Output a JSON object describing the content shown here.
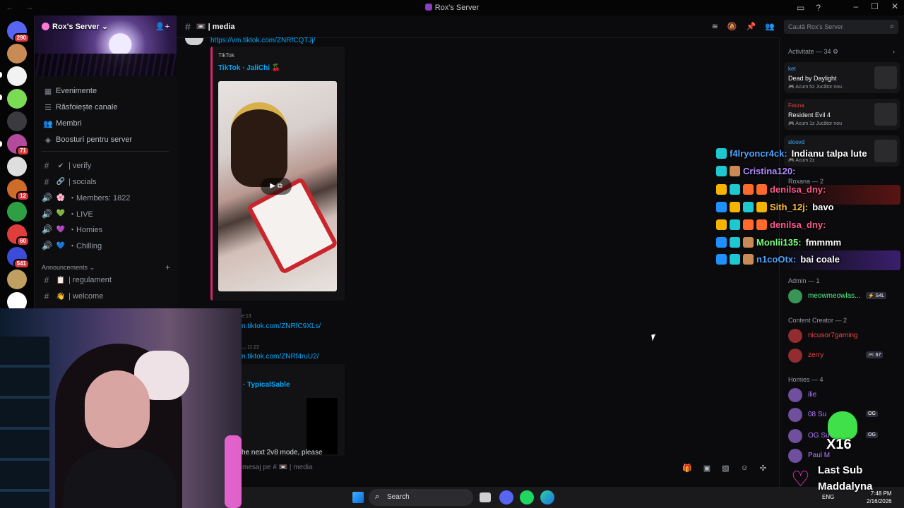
{
  "window": {
    "title": "Rox's Server",
    "nav": "← →"
  },
  "server_list": {
    "badges": [
      "290",
      "71",
      "12",
      "60",
      "541"
    ],
    "colors": [
      "#5865f2",
      "#c98b55",
      "#f2f2f2",
      "#7bdb55",
      "#3a3a40",
      "#b34a9e",
      "#dedede",
      "#d06c2a",
      "#2ea043",
      "#e23d3d",
      "#3b4dd8",
      "#c0a060",
      "#ffffff"
    ]
  },
  "sidebar": {
    "server_name": "Rox's Server",
    "server_chevron": "⌄",
    "nav": [
      {
        "icon": "calendar-icon",
        "glyph": "▦",
        "label": "Evenimente"
      },
      {
        "icon": "browse-channels-icon",
        "glyph": "☰",
        "label": "Răsfoiește canale"
      },
      {
        "icon": "members-icon",
        "glyph": "👥",
        "label": "Membri"
      },
      {
        "icon": "boost-icon",
        "glyph": "◈",
        "label": "Boosturi pentru server"
      }
    ],
    "channels": [
      {
        "glyph": "#",
        "emoji": "✔",
        "label": "| verify"
      },
      {
        "glyph": "#",
        "emoji": "🔗",
        "label": "| socials"
      },
      {
        "glyph": "🔊",
        "emoji": "🌸",
        "label": "・Members: 1822"
      },
      {
        "glyph": "🔊",
        "emoji": "💚",
        "label": "・LIVE"
      },
      {
        "glyph": "🔊",
        "emoji": "💜",
        "label": "・Homies"
      },
      {
        "glyph": "🔊",
        "emoji": "💙",
        "label": "・Chilling"
      }
    ],
    "category": "Announcements",
    "category_channels": [
      {
        "glyph": "#",
        "emoji": "📋",
        "label": "| regulament"
      },
      {
        "glyph": "#",
        "emoji": "👋",
        "label": "| welcome"
      }
    ]
  },
  "header": {
    "channel": "| media",
    "channel_emoji": "📼"
  },
  "search": {
    "placeholder": "Caută Rox's Server"
  },
  "messages": {
    "link1": "https://vm.tiktok.com/ZNRfCQTJj/",
    "embed_provider": "TikTok",
    "embed_author": "TikTok · JaliChi 🍒",
    "time2": "e:13",
    "link2": "n.tiktok.com/ZNRfC9XLs/",
    "time3": "11:22",
    "link3": "n.tiktok.com/ZNRf4ruU2/",
    "embed2_author": "· TypicalSable",
    "embed2_text": "he next 2v8 mode, please"
  },
  "composer": {
    "placeholder": "mesaj pe # 📼 | media"
  },
  "activity": {
    "header": "Activitate — 34",
    "cards": [
      {
        "user": "ket",
        "game": "Dead by Daylight",
        "time": "Acum 5z",
        "status": "Jucător nou",
        "user_color": "#3ba9ff"
      },
      {
        "user": "Fauna",
        "game": "Resident Evil 4",
        "time": "Acum 1z",
        "status": "Jucător nou",
        "user_color": "#e23d3d"
      },
      {
        "user": "sloovd",
        "game": "",
        "time": "Acum 2z",
        "status": "",
        "user_color": "#3ba9ff"
      }
    ]
  },
  "member_sections": [
    {
      "label": "Admin — 1",
      "members": [
        {
          "name": "meowmeowlas...",
          "color": "#57f287",
          "tag": "⚡ S4L"
        }
      ]
    },
    {
      "label": "Content Creator — 2",
      "members": [
        {
          "name": "nicusor7gaming",
          "color": "#ed4245",
          "tag": ""
        },
        {
          "name": "zerry",
          "color": "#ed4245",
          "tag": "🎮 67"
        }
      ]
    },
    {
      "label": "Homies — 4",
      "members": [
        {
          "name": "ilie",
          "color": "#b27dff",
          "tag": ""
        },
        {
          "name": "08 Su",
          "color": "#b27dff",
          "tag": "OG"
        },
        {
          "name": "OG Su",
          "color": "#b27dff",
          "tag": "OG"
        },
        {
          "name": "Paul M",
          "color": "#b27dff",
          "tag": ""
        }
      ]
    },
    {
      "label": "Roxana — 2",
      "members": []
    }
  ],
  "stream_chat": [
    {
      "user": "f4lryoncr4ck:",
      "color": "#4ea3ff",
      "msg": "Indianu talpa lute"
    },
    {
      "user": "Cristina120:",
      "color": "#b18bff",
      "msg": ""
    },
    {
      "user": "denilsa_dny:",
      "color": "#ff5a8c",
      "msg": ""
    },
    {
      "user": "Sith_12j:",
      "color": "#ffbf3a",
      "msg": "bavo"
    },
    {
      "user": "denilsa_dny:",
      "color": "#ff5a8c",
      "msg": ""
    },
    {
      "user": "Monlii135:",
      "color": "#7cff7c",
      "msg": "fmmmm"
    },
    {
      "user": "n1coOtx:",
      "color": "#4ea3ff",
      "msg": "bai coale"
    }
  ],
  "alert": {
    "count": "X16",
    "line1": "Last Sub",
    "line2": "Maddalyna"
  },
  "taskbar": {
    "search": "Search",
    "lang": "ENG",
    "time": "7:48 PM",
    "date": "2/16/2026"
  }
}
